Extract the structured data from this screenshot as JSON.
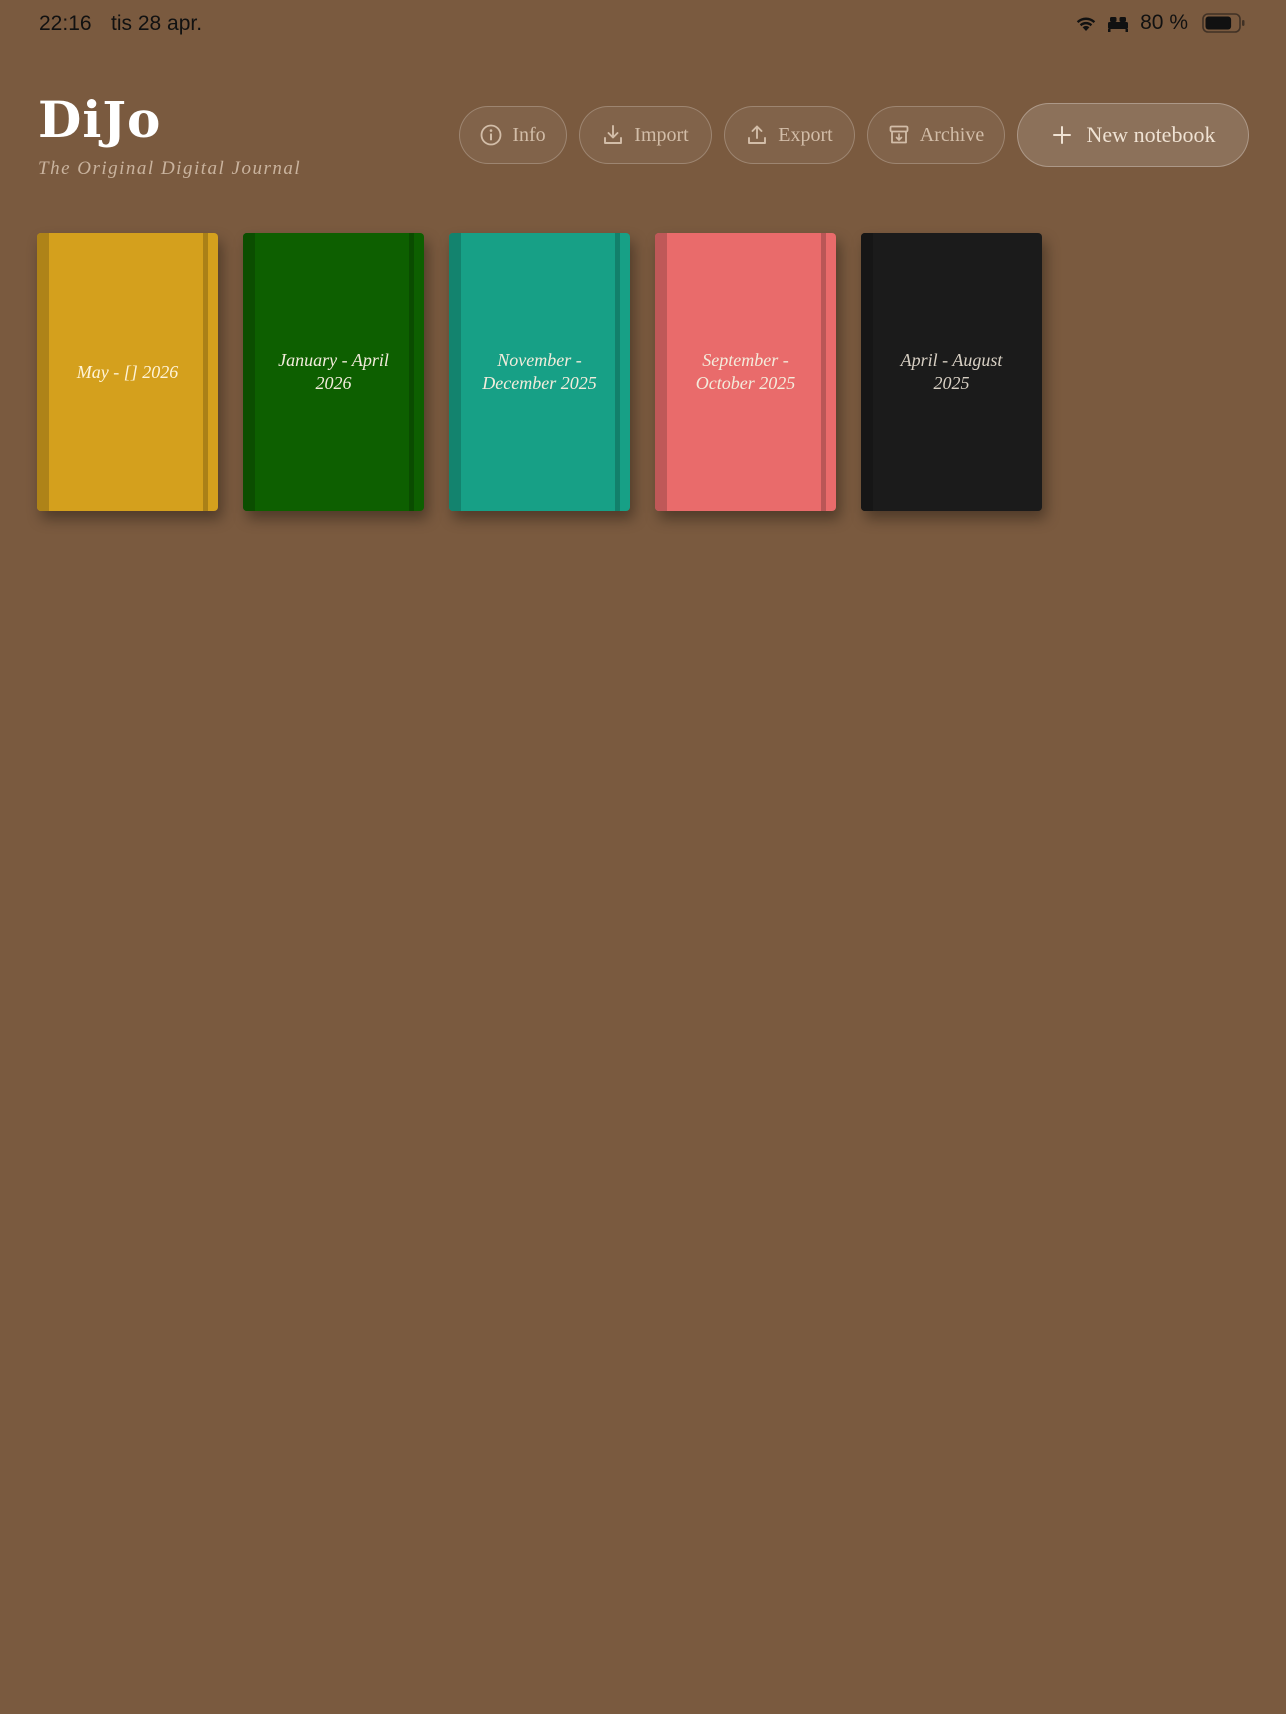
{
  "status_bar": {
    "time": "22:16",
    "date": "tis 28 apr.",
    "battery_percent": "80 %",
    "battery_level": 0.8,
    "icons": [
      "wifi-icon",
      "sleep-focus-icon",
      "battery-icon"
    ]
  },
  "header": {
    "title": "DiJo",
    "subtitle": "The Original Digital Journal"
  },
  "toolbar": {
    "info_label": "Info",
    "import_label": "Import",
    "export_label": "Export",
    "archive_label": "Archive",
    "new_notebook_label": "New notebook"
  },
  "notebooks": [
    {
      "title": "May - [] 2026",
      "color": "#d4a01d"
    },
    {
      "title": "January - April 2026",
      "color": "#0d5f00"
    },
    {
      "title": "November - December 2025",
      "color": "#17a086"
    },
    {
      "title": "September - October 2025",
      "color": "#e96b6b"
    },
    {
      "title": "April - August 2025",
      "color": "#1b1b1b"
    }
  ],
  "colors": {
    "background": "#7a5a3f",
    "title": "#ffffff",
    "subtitle": "#c9b39e",
    "button_text": "#d2bda8"
  }
}
